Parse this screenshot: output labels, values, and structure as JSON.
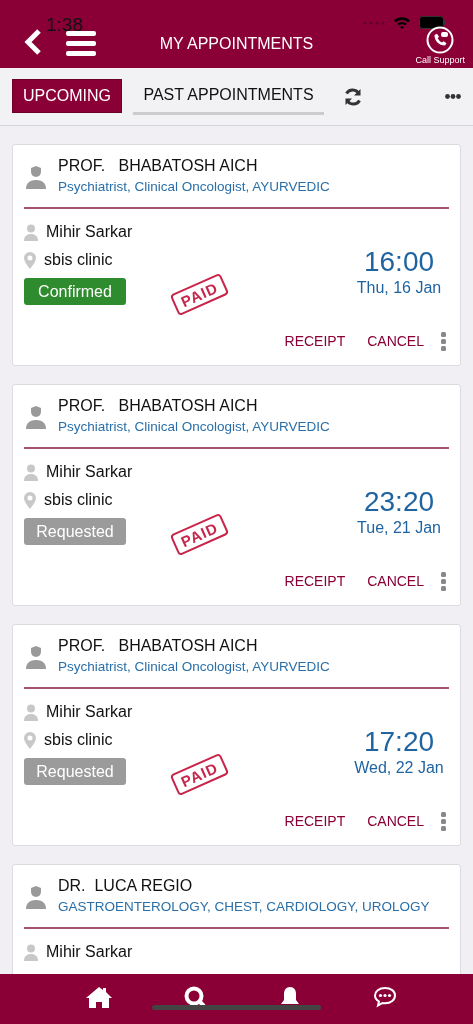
{
  "status_bar": {
    "time": "1:38"
  },
  "header": {
    "title": "MY APPOINTMENTS",
    "support_label": "Call Support"
  },
  "tabs": [
    {
      "label": "UPCOMING",
      "selected": true
    },
    {
      "label": "PAST APPOINTMENTS",
      "selected": false
    }
  ],
  "appointments": [
    {
      "doctor": "PROF.   BHABATOSH AICH",
      "specialty": "Psychiatrist, Clinical Oncologist, AYURVEDIC",
      "patient": "Mihir Sarkar",
      "clinic": "sbis clinic",
      "status": {
        "label": "Confirmed",
        "kind": "confirmed"
      },
      "stamp": "PAID",
      "time": "16:00",
      "date": "Thu, 16 Jan",
      "actions": [
        "RECEIPT",
        "CANCEL"
      ]
    },
    {
      "doctor": "PROF.   BHABATOSH AICH",
      "specialty": "Psychiatrist, Clinical Oncologist, AYURVEDIC",
      "patient": "Mihir Sarkar",
      "clinic": "sbis clinic",
      "status": {
        "label": "Requested",
        "kind": "requested"
      },
      "stamp": "PAID",
      "time": "23:20",
      "date": "Tue, 21 Jan",
      "actions": [
        "RECEIPT",
        "CANCEL"
      ]
    },
    {
      "doctor": "PROF.   BHABATOSH AICH",
      "specialty": "Psychiatrist, Clinical Oncologist, AYURVEDIC",
      "patient": "Mihir Sarkar",
      "clinic": "sbis clinic",
      "status": {
        "label": "Requested",
        "kind": "requested"
      },
      "stamp": "PAID",
      "time": "17:20",
      "date": "Wed, 22 Jan",
      "actions": [
        "RECEIPT",
        "CANCEL"
      ]
    },
    {
      "doctor": "DR.  LUCA REGIO",
      "specialty": "GASTROENTEROLOGY, CHEST, CARDIOLOGY, UROLOGY",
      "patient": "Mihir Sarkar"
    }
  ]
}
